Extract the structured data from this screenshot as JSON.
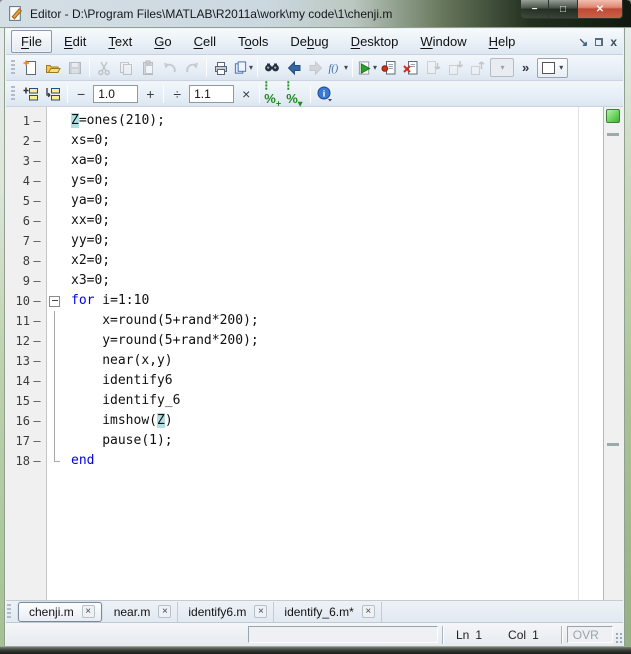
{
  "colors": {
    "keyword": "#0000e6",
    "var_highlight_bg": "#b2e0e2",
    "message_bar_ok": "#4cbf4c",
    "close_button": "#c0503c",
    "frame_green": "#a8c497"
  },
  "window": {
    "title": "Editor - D:\\Program Files\\MATLAB\\R2011a\\work\\my code\\1\\chenji.m",
    "buttons": {
      "minimize": "−",
      "maximize": "□",
      "close": "✕"
    }
  },
  "menu": {
    "items": [
      {
        "pre": "",
        "key": "F",
        "post": "ile",
        "active": true
      },
      {
        "pre": "",
        "key": "E",
        "post": "dit"
      },
      {
        "pre": "",
        "key": "T",
        "post": "ext"
      },
      {
        "pre": "",
        "key": "G",
        "post": "o"
      },
      {
        "pre": "",
        "key": "C",
        "post": "ell"
      },
      {
        "pre": "T",
        "key": "o",
        "post": "ols"
      },
      {
        "pre": "De",
        "key": "b",
        "post": "ug"
      },
      {
        "pre": "",
        "key": "D",
        "post": "esktop"
      },
      {
        "pre": "",
        "key": "W",
        "post": "indow"
      },
      {
        "pre": "",
        "key": "H",
        "post": "elp"
      }
    ],
    "right_icons": [
      "dock-icon",
      "restore-icon",
      "close-icon"
    ]
  },
  "toolbar1": {
    "buttons": [
      {
        "name": "new-file",
        "enabled": true
      },
      {
        "name": "open",
        "enabled": true
      },
      {
        "name": "save",
        "enabled": false,
        "sep": true
      },
      {
        "name": "cut",
        "enabled": false
      },
      {
        "name": "copy",
        "enabled": false
      },
      {
        "name": "paste",
        "enabled": false
      },
      {
        "name": "undo",
        "enabled": false
      },
      {
        "name": "redo",
        "enabled": false,
        "sep": true
      },
      {
        "name": "print",
        "enabled": true
      },
      {
        "name": "publish",
        "enabled": true,
        "dropdown": true,
        "sep": true
      },
      {
        "name": "find",
        "enabled": true
      },
      {
        "name": "go-back",
        "enabled": true
      },
      {
        "name": "go-forward",
        "enabled": false
      },
      {
        "name": "function-browser",
        "enabled": true,
        "dropdown": true,
        "sep": true
      },
      {
        "name": "run",
        "enabled": true,
        "dropdown": true
      },
      {
        "name": "set-breakpoint",
        "enabled": true
      },
      {
        "name": "clear-breakpoints",
        "enabled": true
      },
      {
        "name": "step",
        "enabled": false
      },
      {
        "name": "step-in",
        "enabled": false
      },
      {
        "name": "step-out",
        "enabled": false
      }
    ],
    "overflow_chevron": "»"
  },
  "toolbar2": {
    "minus_label": "−",
    "plus_label": "+",
    "divide_label": "÷",
    "multiply_label": "×",
    "field1": "1.0",
    "field2": "1.1",
    "icons": [
      "insert-cell-divider-icon",
      "insert-cell-around-icon",
      "eval-cell-icon",
      "eval-cell-advance-icon",
      "info-icon"
    ]
  },
  "editor": {
    "lines": [
      {
        "n": "1",
        "fold": "none",
        "indent": 0,
        "seg": [
          {
            "t": "Z",
            "c": "hl"
          },
          {
            "t": "=ones(210);",
            "c": "p"
          }
        ]
      },
      {
        "n": "2",
        "fold": "none",
        "indent": 0,
        "seg": [
          {
            "t": "xs=0;",
            "c": "p"
          }
        ]
      },
      {
        "n": "3",
        "fold": "none",
        "indent": 0,
        "seg": [
          {
            "t": "xa=0;",
            "c": "p"
          }
        ]
      },
      {
        "n": "4",
        "fold": "none",
        "indent": 0,
        "seg": [
          {
            "t": "ys=0;",
            "c": "p"
          }
        ]
      },
      {
        "n": "5",
        "fold": "none",
        "indent": 0,
        "seg": [
          {
            "t": "ya=0;",
            "c": "p"
          }
        ]
      },
      {
        "n": "6",
        "fold": "none",
        "indent": 0,
        "seg": [
          {
            "t": "xx=0;",
            "c": "p"
          }
        ]
      },
      {
        "n": "7",
        "fold": "none",
        "indent": 0,
        "seg": [
          {
            "t": "yy=0;",
            "c": "p"
          }
        ]
      },
      {
        "n": "8",
        "fold": "none",
        "indent": 0,
        "seg": [
          {
            "t": "x2=0;",
            "c": "p"
          }
        ]
      },
      {
        "n": "9",
        "fold": "none",
        "indent": 0,
        "seg": [
          {
            "t": "x3=0;",
            "c": "p"
          }
        ]
      },
      {
        "n": "10",
        "fold": "open",
        "indent": 0,
        "seg": [
          {
            "t": "for",
            "c": "k"
          },
          {
            "t": " i=1:10",
            "c": "p"
          }
        ]
      },
      {
        "n": "11",
        "fold": "line",
        "indent": 4,
        "seg": [
          {
            "t": "x=round(5+rand*200);",
            "c": "p"
          }
        ]
      },
      {
        "n": "12",
        "fold": "line",
        "indent": 4,
        "seg": [
          {
            "t": "y=round(5+rand*200);",
            "c": "p"
          }
        ]
      },
      {
        "n": "13",
        "fold": "line",
        "indent": 4,
        "seg": [
          {
            "t": "near(x,y)",
            "c": "p"
          }
        ]
      },
      {
        "n": "14",
        "fold": "line",
        "indent": 4,
        "seg": [
          {
            "t": "identify6",
            "c": "p"
          }
        ]
      },
      {
        "n": "15",
        "fold": "line",
        "indent": 4,
        "seg": [
          {
            "t": "identify_6",
            "c": "p"
          }
        ]
      },
      {
        "n": "16",
        "fold": "line",
        "indent": 4,
        "seg": [
          {
            "t": "imshow(",
            "c": "p"
          },
          {
            "t": "Z",
            "c": "hl"
          },
          {
            "t": ")",
            "c": "p"
          }
        ]
      },
      {
        "n": "17",
        "fold": "line",
        "indent": 4,
        "seg": [
          {
            "t": "pause(1);",
            "c": "p"
          }
        ]
      },
      {
        "n": "18",
        "fold": "end",
        "indent": 0,
        "seg": [
          {
            "t": "end",
            "c": "k"
          }
        ]
      }
    ],
    "executable_marker": "–"
  },
  "tabs": [
    {
      "label": "chenji.m",
      "close": "×",
      "active": true
    },
    {
      "label": "near.m",
      "close": "×",
      "active": false
    },
    {
      "label": "identify6.m",
      "close": "×",
      "active": false
    },
    {
      "label": "identify_6.m*",
      "close": "×",
      "active": false
    }
  ],
  "status": {
    "ln_label": "Ln",
    "ln_value": "1",
    "col_label": "Col",
    "col_value": "1",
    "ovr": "OVR"
  }
}
